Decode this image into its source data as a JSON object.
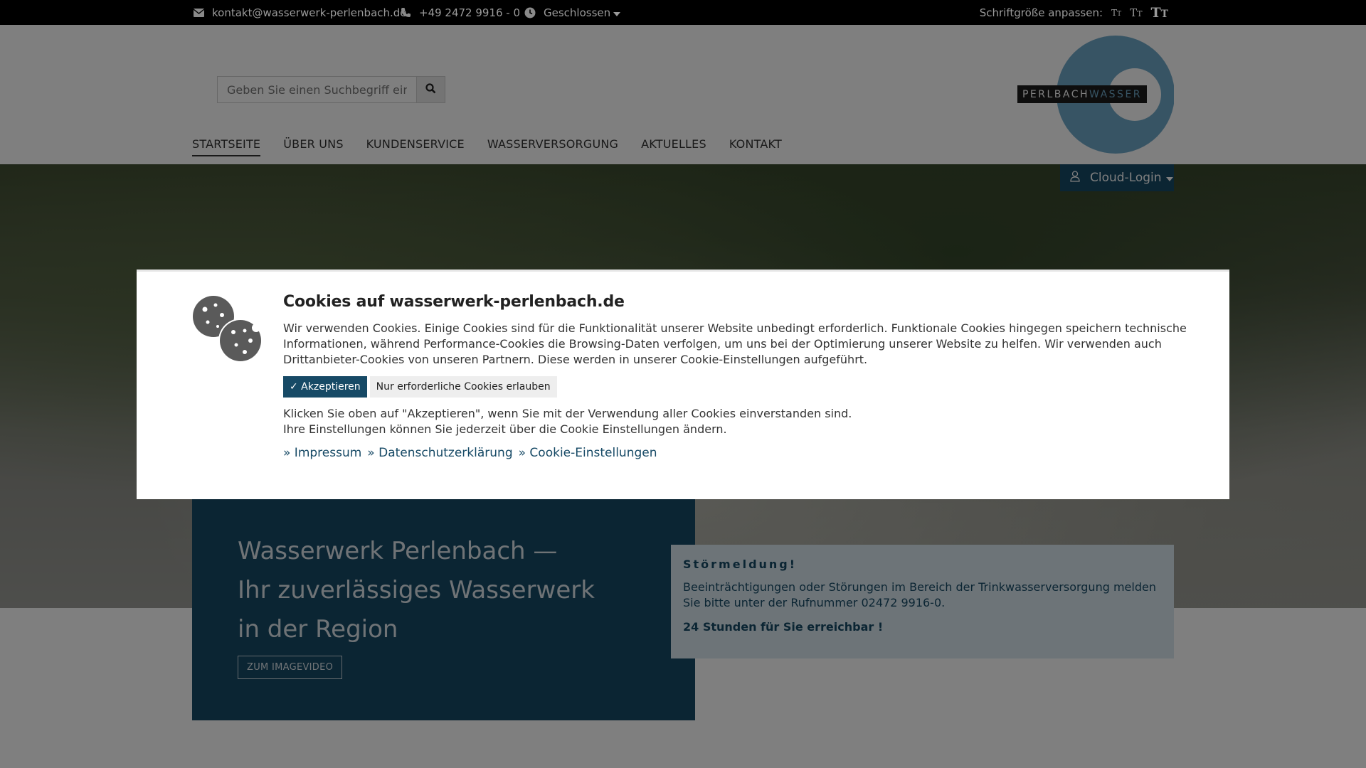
{
  "topbar": {
    "email": "kontakt@wasserwerk-perlenbach.de",
    "phone": "+49 2472 9916 - 0",
    "opening_status": "Geschlossen",
    "fontsize_label": "Schriftgröße anpassen:",
    "fontsize_small": "TT",
    "fontsize_medium": "TT",
    "fontsize_large": "TT",
    "icons": {
      "email": "envelope-icon",
      "phone": "phone-icon",
      "clock": "clock-icon",
      "caret": "caret-down-icon"
    }
  },
  "header": {
    "search_placeholder": "Geben Sie einen Suchbegriff ein",
    "search_icon": "search-icon",
    "logo_text_left": "PERLBACH",
    "logo_text_right": "WASSER",
    "nav": [
      {
        "label": "STARTSEITE",
        "active": true
      },
      {
        "label": "ÜBER UNS"
      },
      {
        "label": "KUNDENSERVICE"
      },
      {
        "label": "WASSERVERSORGUNG"
      },
      {
        "label": "AKTUELLES"
      },
      {
        "label": "KONTAKT"
      }
    ]
  },
  "cloud_login": {
    "label": "Cloud-Login",
    "icon": "user-icon"
  },
  "hero": {
    "title_line1": "Wasserwerk Perlenbach —",
    "title_line2": "Ihr zuverlässiges Wasserwerk",
    "title_line3": "in der Region",
    "button": "ZUM IMAGEVIDEO"
  },
  "notice": {
    "title": "Störmeldung!",
    "text": "Beeinträchtigungen oder Störungen im Bereich der Trinkwasserversorgung melden Sie bitte unter der Rufnummer 02472 9916-0.",
    "highlight": "24 Stunden für Sie erreichbar !"
  },
  "cookie": {
    "title": "Cookies auf wasserwerk-perlenbach.de",
    "text": "Wir verwenden Cookies. Einige Cookies sind für die Funktionalität unserer Website unbedingt erforderlich. Funktionale Cookies hingegen speichern technische Informationen, während Performance-Cookies die Browsing-Daten verfolgen, um uns bei der Optimierung unserer Website zu helfen. Wir verwenden auch Drittanbieter-Cookies von unseren Partnern. Diese werden in unserer Cookie-Einstellungen aufgeführt.",
    "accept": "✓ Akzeptieren",
    "required_only": "Nur erforderliche Cookies erlauben",
    "hint_line1": "Klicken Sie oben auf \"Akzeptieren\", wenn Sie mit der Verwendung aller Cookies einverstanden sind.",
    "hint_line2": "Ihre Einstellungen können Sie jederzeit über die Cookie Einstellungen ändern.",
    "links": [
      "» Impressum",
      "» Datenschutzerklärung",
      "» Cookie-Einstellungen"
    ],
    "icon": "cookie-icon"
  },
  "colors": {
    "brand": "#174a66",
    "notice_bg": "#dbe9f1",
    "logo_circle": "#6fa8c8"
  }
}
